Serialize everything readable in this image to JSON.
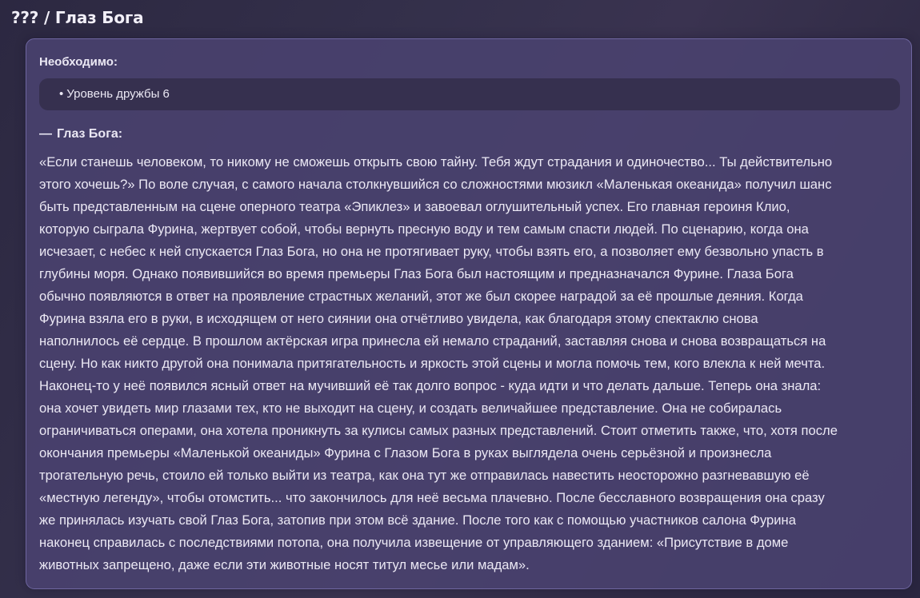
{
  "header": {
    "title": "??? / Глаз Бога"
  },
  "requirements": {
    "label": "Необходимо:",
    "bullet": "•",
    "items": [
      "Уровень дружбы 6"
    ]
  },
  "story": {
    "dash": "—",
    "title": "Глаз Бога:",
    "lines": [
      "«Если станешь человеком, то никому не сможешь открыть свою тайну. Тебя ждут страдания и одиночество... Ты действительно",
      "этого хочешь?» По воле случая, с самого начала столкнувшийся со сложностями мюзикл «Маленькая океанида» получил шанс",
      "быть представленным на сцене оперного театра «Эпиклез» и завоевал оглушительный успех. Его главная героиня Клио,",
      "которую сыграла Фурина, жертвует собой, чтобы вернуть пресную воду и тем самым спасти людей. По сценарию, когда она",
      "исчезает, с небес к ней спускается Глаз Бога, но она не протягивает руку, чтобы взять его, а позволяет ему безвольно упасть в",
      "глубины моря. Однако появившийся во время премьеры Глаз Бога был настоящим и предназначался Фурине. Глаза Бога",
      "обычно появляются в ответ на проявление страстных желаний, этот же был скорее наградой за её прошлые деяния. Когда",
      "Фурина взяла его в руки, в исходящем от него сиянии она отчётливо увидела, как благодаря этому спектаклю снова",
      "наполнилось её сердце. В прошлом актёрская игра принесла ей немало страданий, заставляя снова и снова возвращаться на",
      "сцену. Но как никто другой она понимала притягательность и яркость этой сцены и могла помочь тем, кого влекла к ней мечта.",
      "Наконец-то у неё появился ясный ответ на мучивший её так долго вопрос - куда идти и что делать дальше. Теперь она знала:",
      "она хочет увидеть мир глазами тех, кто не выходит на сцену, и создать величайшее представление. Она не собиралась",
      "ограничиваться операми, она хотела проникнуть за кулисы самых разных представлений. Стоит отметить также, что, хотя после",
      "окончания премьеры «Маленькой океаниды» Фурина с Глазом Бога в руках выглядела очень серьёзной и произнесла",
      "трогательную речь, стоило ей только выйти из театра, как она тут же отправилась навестить неосторожно разгневавшую её",
      "«местную легенду», чтобы отомстить... что закончилось для неё весьма плачевно. После бесславного возвращения она сразу",
      "же принялась изучать свой Глаз Бога, затопив при этом всё здание. После того как с помощью участников салона Фурина",
      "наконец справилась с последствиями потопа, она получила извещение от управляющего зданием: «Присутствие в доме",
      "животных запрещено, даже если эти животные носят титул месье или мадам»."
    ]
  }
}
